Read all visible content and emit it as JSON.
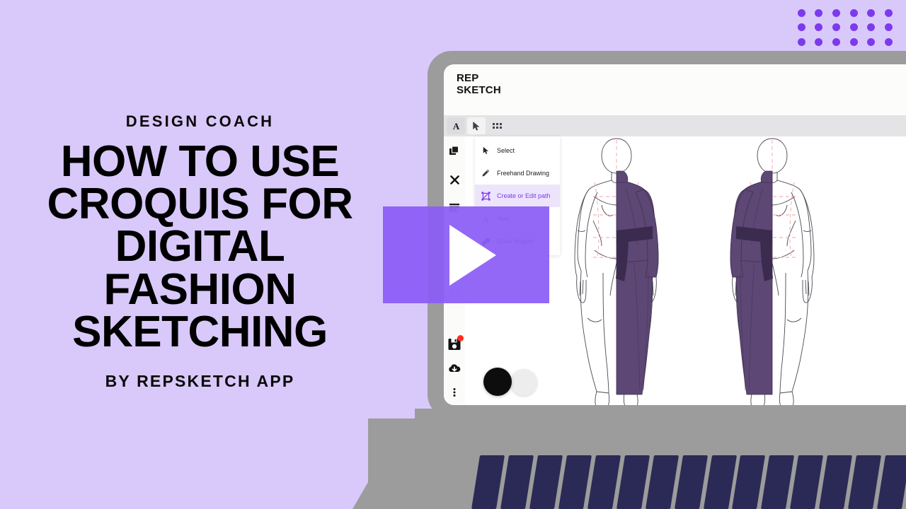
{
  "theme": {
    "background": "#d9c9fa",
    "accent": "#7c3aed",
    "play_overlay": "#8b5cf6",
    "laptop_body": "#9c9c9c",
    "key_color": "#2b2a56",
    "garment_purple": "#5d4774",
    "garment_dark": "#3b2b4e",
    "guide_line": "#f2a6ac"
  },
  "promo": {
    "eyebrow": "DESIGN COACH",
    "title": "HOW TO USE CROQUIS FOR DIGITAL FASHION SKETCHING",
    "byline": "BY REPSKETCH APP"
  },
  "play_button": {
    "icon": "play-triangle-icon",
    "label": "Play"
  },
  "app": {
    "logo": "REP\nSKETCH",
    "top_toolbar": [
      {
        "id": "text-tool",
        "icon": "letter-a-icon",
        "state": "shaded"
      },
      {
        "id": "select-tool",
        "icon": "cursor-arrow-icon",
        "state": "active"
      },
      {
        "id": "grid-tool",
        "icon": "grid-dots-icon",
        "state": "normal"
      }
    ],
    "tool_rail": [
      {
        "id": "duplicate",
        "icon": "copy-layers-icon"
      },
      {
        "id": "delete",
        "icon": "close-x-icon"
      },
      {
        "id": "align",
        "icon": "align-lines-icon"
      },
      {
        "id": "sort-asc",
        "icon": "sort-ascending-icon"
      },
      {
        "id": "sort-desc",
        "icon": "sort-descending-icon"
      },
      {
        "id": "line-height",
        "icon": "line-height-icon"
      }
    ],
    "tool_rail_bottom": [
      {
        "id": "save",
        "icon": "save-disk-icon",
        "badge": true
      },
      {
        "id": "download",
        "icon": "cloud-download-icon",
        "badge": false
      },
      {
        "id": "more",
        "icon": "vertical-dots-icon",
        "badge": false
      }
    ],
    "tool_menu": [
      {
        "label": "Select",
        "icon": "cursor-arrow-icon",
        "selected": false,
        "dim": false
      },
      {
        "label": "Freehand Drawing",
        "icon": "pencil-icon",
        "selected": false,
        "dim": false
      },
      {
        "label": "Create or Edit path",
        "icon": "path-node-icon",
        "selected": true,
        "dim": false
      },
      {
        "label": "Text",
        "icon": "letter-a-icon",
        "selected": false,
        "dim": true
      },
      {
        "label": "Draw shapes",
        "icon": "shapes-icon",
        "selected": false,
        "dim": true
      }
    ],
    "swatches": {
      "fill": "#0d0d0d",
      "stroke": "#ededed"
    },
    "canvas": {
      "figures": [
        {
          "id": "croquis-left",
          "drape_side": "right",
          "garment": "asymmetric-draped-gown"
        },
        {
          "id": "croquis-right",
          "drape_side": "left",
          "garment": "asymmetric-draped-gown"
        }
      ]
    }
  },
  "decor": {
    "dot_grid": {
      "columns": 6,
      "rows": 3,
      "count": 18,
      "color": "#7c3aed"
    },
    "keyboard_keys": 15
  }
}
